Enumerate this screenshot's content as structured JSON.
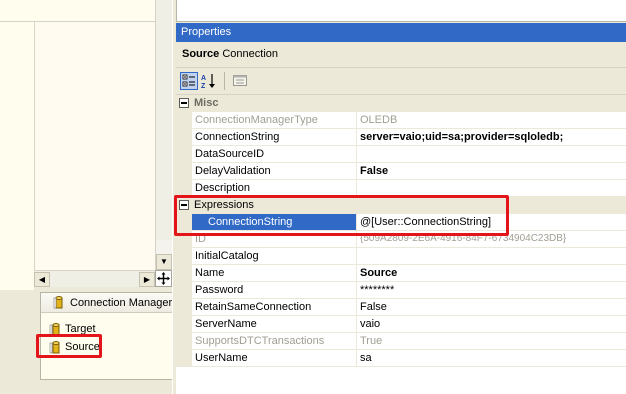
{
  "left_pane": {
    "connection_managers_tab": "Connection Managers",
    "connections": [
      {
        "label": "Target"
      },
      {
        "label": "Source"
      }
    ]
  },
  "properties": {
    "title": "Properties",
    "object_name": "Source",
    "object_type": "Connection",
    "toolbar": [
      "categorized-icon",
      "alphabetical-icon",
      "property-pages-icon"
    ],
    "categories": [
      {
        "label": "Misc"
      },
      {
        "label": "Expressions"
      }
    ],
    "rows": [
      {
        "name": "ConnectionManagerType",
        "value": "OLEDB",
        "state": "disabled"
      },
      {
        "name": "ConnectionString",
        "value": "server=vaio;uid=sa;provider=sqloledb;",
        "state": "bold"
      },
      {
        "name": "DataSourceID",
        "value": ""
      },
      {
        "name": "DelayValidation",
        "value": "False",
        "state": "bold"
      },
      {
        "name": "Description",
        "value": ""
      },
      {
        "name": "ConnectionString",
        "value": "@[User::ConnectionString]",
        "state": "selected"
      },
      {
        "name": "ID",
        "value": "{509A2809-2E6A-4916-84F7-6734904C23DB}",
        "state": "disabled"
      },
      {
        "name": "InitialCatalog",
        "value": ""
      },
      {
        "name": "Name",
        "value": "Source",
        "state": "bold"
      },
      {
        "name": "Password",
        "value": "********"
      },
      {
        "name": "RetainSameConnection",
        "value": "False"
      },
      {
        "name": "ServerName",
        "value": "vaio"
      },
      {
        "name": "SupportsDTCTransactions",
        "value": "True",
        "state": "disabled"
      },
      {
        "name": "UserName",
        "value": "sa"
      }
    ]
  },
  "colors": {
    "title_bar": "#3169c6",
    "highlight_box": "#e3151a",
    "selected_row": "#3169c6"
  }
}
